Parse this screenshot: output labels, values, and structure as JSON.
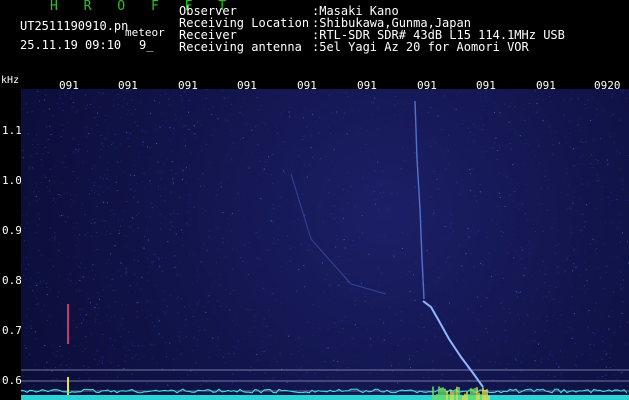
{
  "header": {
    "station": "H R O F F T",
    "filename": "UT2511190910.pn",
    "event": "meteor",
    "datetime": "25.11.19 09:10",
    "code": "9_",
    "rows": [
      {
        "label": "Observer",
        "value": ":Masaki Kano"
      },
      {
        "label": "Receiving Location",
        "value": ":Shibukawa,Gunma,Japan"
      },
      {
        "label": "Receiver",
        "value": ":RTL-SDR SDR# 43dB L15 114.1MHz USB"
      },
      {
        "label": "Receiving antenna",
        "value": ":5el Yagi Az 20 for Aomori VOR"
      }
    ]
  },
  "axes": {
    "unit": "kHz",
    "x_ticks": [
      "091",
      "091",
      "091",
      "091",
      "091",
      "091",
      "091",
      "091",
      "091",
      "0920"
    ],
    "y_ticks": [
      "1.1",
      "1.0",
      "0.9",
      "0.8",
      "0.7",
      "0.6"
    ]
  },
  "colors": {
    "title": "#22c81f",
    "background": "#0f1244",
    "echo": "#8fb8ff",
    "baseline": "#3fe8e8"
  }
}
